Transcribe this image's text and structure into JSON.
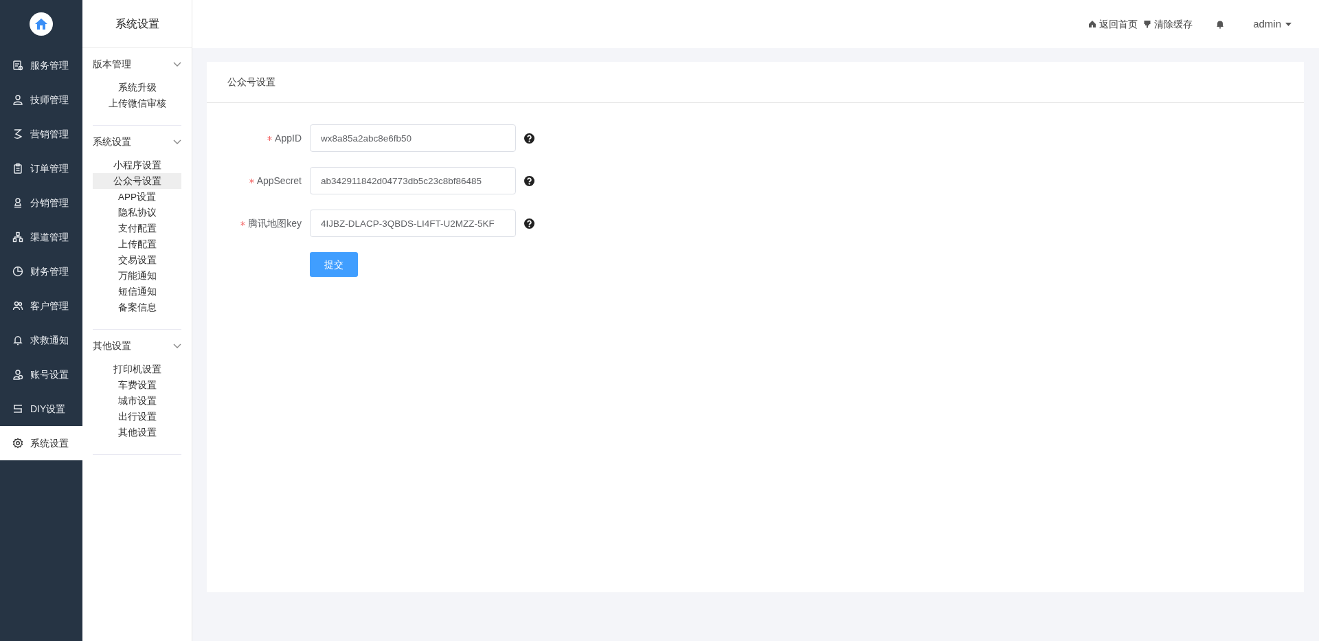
{
  "nav": {
    "items": [
      {
        "label": "服务管理",
        "selected": false
      },
      {
        "label": "技师管理",
        "selected": false
      },
      {
        "label": "营销管理",
        "selected": false
      },
      {
        "label": "订单管理",
        "selected": false
      },
      {
        "label": "分销管理",
        "selected": false
      },
      {
        "label": "渠道管理",
        "selected": false
      },
      {
        "label": "财务管理",
        "selected": false
      },
      {
        "label": "客户管理",
        "selected": false
      },
      {
        "label": "求救通知",
        "selected": false
      },
      {
        "label": "账号设置",
        "selected": false
      },
      {
        "label": "DIY设置",
        "selected": false
      },
      {
        "label": "系统设置",
        "selected": true
      }
    ]
  },
  "subnav": {
    "title": "系统设置",
    "groups": [
      {
        "title": "版本管理",
        "expanded": true,
        "items": [
          {
            "label": "系统升级",
            "selected": false
          },
          {
            "label": "上传微信审核",
            "selected": false
          }
        ]
      },
      {
        "title": "系统设置",
        "expanded": true,
        "items": [
          {
            "label": "小程序设置",
            "selected": false
          },
          {
            "label": "公众号设置",
            "selected": true
          },
          {
            "label": "APP设置",
            "selected": false
          },
          {
            "label": "隐私协议",
            "selected": false
          },
          {
            "label": "支付配置",
            "selected": false
          },
          {
            "label": "上传配置",
            "selected": false
          },
          {
            "label": "交易设置",
            "selected": false
          },
          {
            "label": "万能通知",
            "selected": false
          },
          {
            "label": "短信通知",
            "selected": false
          },
          {
            "label": "备案信息",
            "selected": false
          }
        ]
      },
      {
        "title": "其他设置",
        "expanded": true,
        "items": [
          {
            "label": "打印机设置",
            "selected": false
          },
          {
            "label": "车费设置",
            "selected": false
          },
          {
            "label": "城市设置",
            "selected": false
          },
          {
            "label": "出行设置",
            "selected": false
          },
          {
            "label": "其他设置",
            "selected": false
          }
        ]
      }
    ]
  },
  "header": {
    "links": [
      {
        "label": "返回首页"
      },
      {
        "label": "清除缓存"
      }
    ],
    "user": "admin"
  },
  "card": {
    "title": "公众号设置",
    "fields": [
      {
        "label": "AppID",
        "required": true,
        "value": "wx8a85a2abc8e6fb50"
      },
      {
        "label": "AppSecret",
        "required": true,
        "value": "ab342911842d04773db5c23c8bf86485"
      },
      {
        "label": "腾讯地图key",
        "required": true,
        "value": "4IJBZ-DLACP-3QBDS-LI4FT-U2MZZ-5KF"
      }
    ],
    "submit": "提交"
  }
}
